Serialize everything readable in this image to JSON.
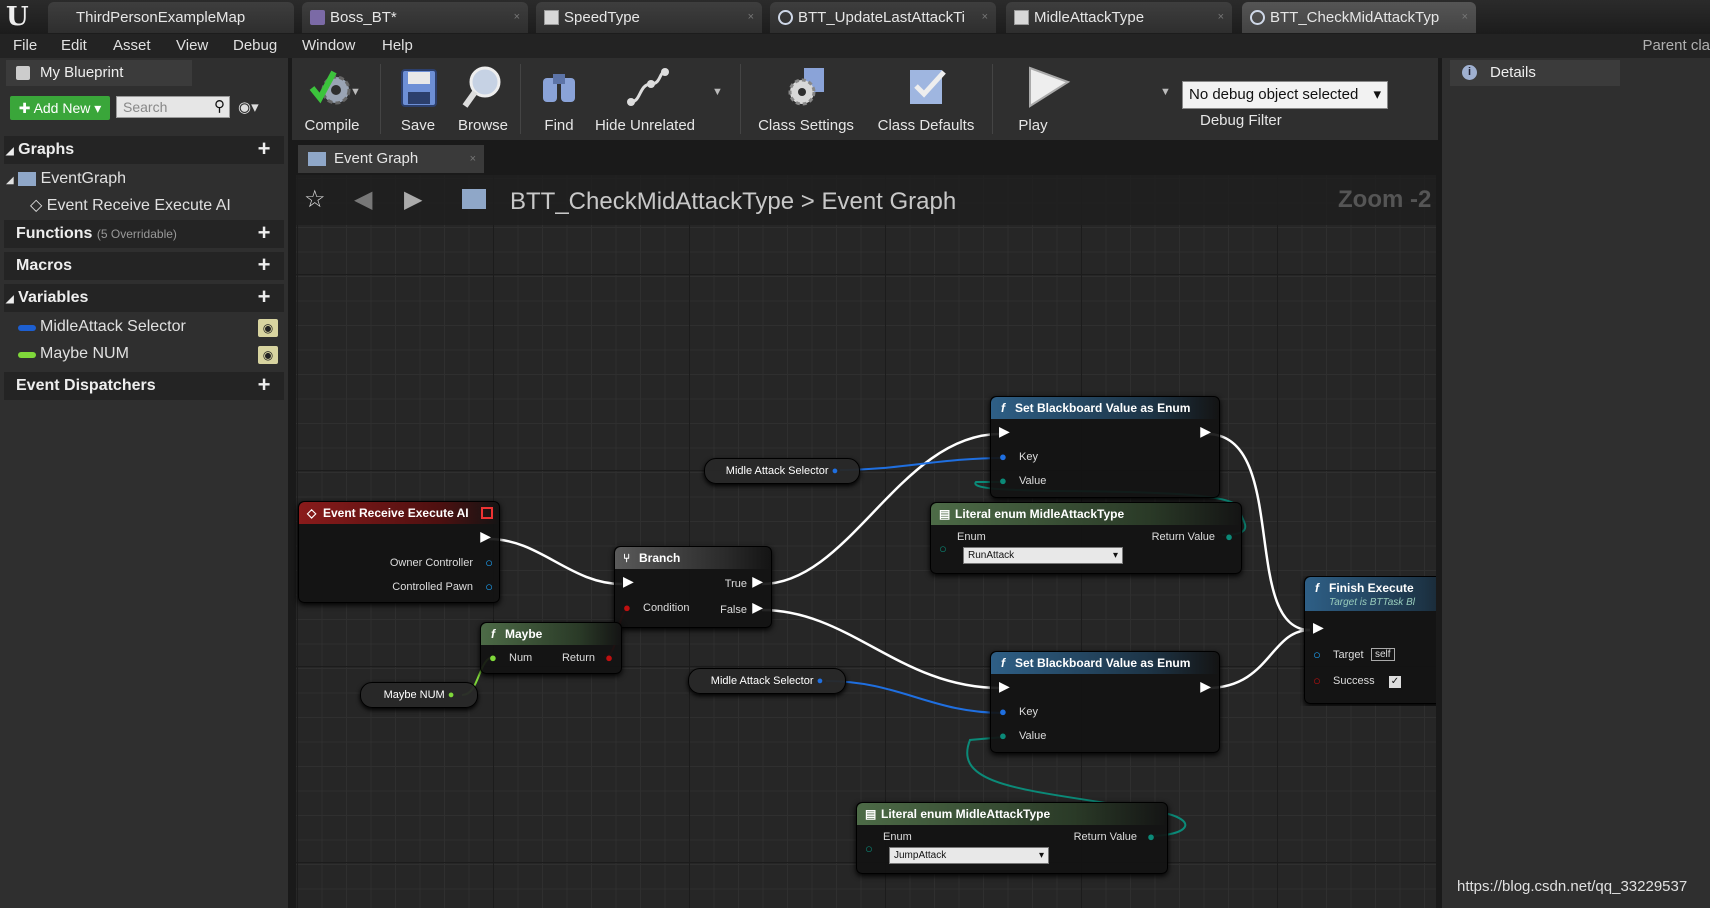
{
  "tabs": [
    {
      "label": "ThirdPersonExampleMap",
      "icon": "map-icon"
    },
    {
      "label": "Boss_BT*",
      "icon": "behavior-tree-icon"
    },
    {
      "label": "SpeedType",
      "icon": "enum-doc-icon"
    },
    {
      "label": "BTT_UpdateLastAttackTi",
      "icon": "blueprint-icon"
    },
    {
      "label": "MidleAttackType",
      "icon": "enum-doc-icon"
    },
    {
      "label": "BTT_CheckMidAttackTyp",
      "icon": "blueprint-icon"
    }
  ],
  "menu": [
    "File",
    "Edit",
    "Asset",
    "View",
    "Debug",
    "Window",
    "Help"
  ],
  "parent_class": "Parent cla",
  "my_blueprint": {
    "title": "My Blueprint",
    "add_new": "Add New",
    "search_placeholder": "Search",
    "graphs_header": "Graphs",
    "event_graph": "EventGraph",
    "event_item": "Event Receive Execute AI",
    "functions_header": "Functions",
    "functions_note": "(5 Overridable)",
    "macros_header": "Macros",
    "variables_header": "Variables",
    "variables": [
      {
        "name": "MidleAttack Selector",
        "color": "#1d5fd1"
      },
      {
        "name": "Maybe NUM",
        "color": "#7fd83a"
      }
    ],
    "dispatchers_header": "Event Dispatchers"
  },
  "toolbar": {
    "compile": "Compile",
    "save": "Save",
    "browse": "Browse",
    "find": "Find",
    "hide_unrelated": "Hide Unrelated",
    "class_settings": "Class Settings",
    "class_defaults": "Class Defaults",
    "play": "Play",
    "debug_object": "No debug object selected",
    "debug_filter": "Debug Filter"
  },
  "details": {
    "title": "Details"
  },
  "graph": {
    "tab_label": "Event Graph",
    "breadcrumb_blueprint": "BTT_CheckMidAttackType",
    "breadcrumb_separator": ">",
    "breadcrumb_graph": "Event Graph",
    "zoom": "Zoom -2"
  },
  "nodes": {
    "event": {
      "title": "Event Receive Execute AI",
      "owner": "Owner Controller",
      "pawn": "Controlled Pawn"
    },
    "branch": {
      "title": "Branch",
      "condition": "Condition",
      "true": "True",
      "false": "False"
    },
    "maybe": {
      "title": "Maybe",
      "num": "Num",
      "ret": "Return"
    },
    "maybe_var": "Maybe NUM",
    "selector_var_1": "Midle Attack Selector",
    "selector_var_2": "Midle Attack Selector",
    "set_bb_1": {
      "title": "Set Blackboard Value as Enum",
      "key": "Key",
      "value": "Value"
    },
    "set_bb_2": {
      "title": "Set Blackboard Value as Enum",
      "key": "Key",
      "value": "Value"
    },
    "literal_1": {
      "title": "Literal enum MidleAttackType",
      "enum_label": "Enum",
      "ret": "Return Value",
      "selected": "RunAttack"
    },
    "literal_2": {
      "title": "Literal enum MidleAttackType",
      "enum_label": "Enum",
      "ret": "Return Value",
      "selected": "JumpAttack"
    },
    "finish": {
      "title": "Finish Execute",
      "subtitle": "Target is BTTask Bl",
      "target": "Target",
      "self": "self",
      "success": "Success"
    }
  },
  "watermark": "https://blog.csdn.net/qq_33229537"
}
